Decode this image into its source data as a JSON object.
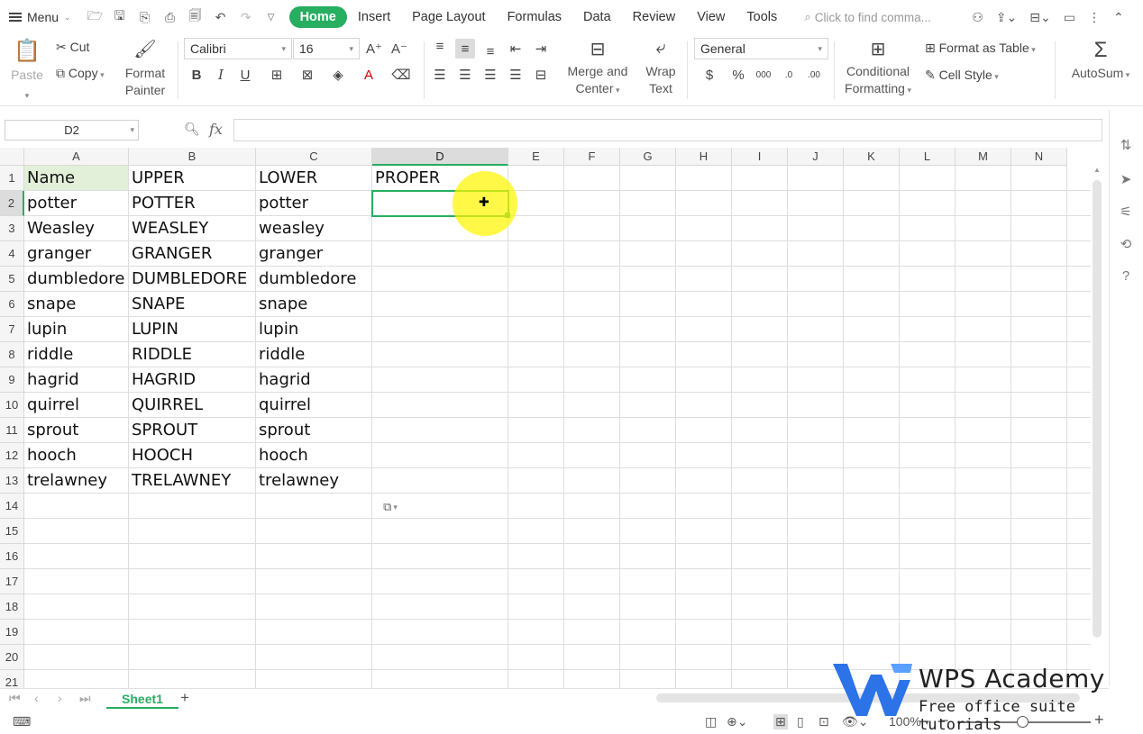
{
  "menubar": {
    "menu_label": "Menu",
    "tabs": [
      "Home",
      "Insert",
      "Page Layout",
      "Formulas",
      "Data",
      "Review",
      "View",
      "Tools"
    ],
    "active_tab": "Home",
    "search_placeholder": "Click to find comma..."
  },
  "ribbon": {
    "paste": "Paste",
    "cut": "Cut",
    "copy": "Copy",
    "format_painter_1": "Format",
    "format_painter_2": "Painter",
    "font_name": "Calibri",
    "font_size": "16",
    "merge_1": "Merge and",
    "merge_2": "Center",
    "wrap_1": "Wrap",
    "wrap_2": "Text",
    "number_format": "General",
    "conditional_1": "Conditional",
    "conditional_2": "Formatting",
    "format_as_table": "Format as Table",
    "cell_style": "Cell Style",
    "autosum": "AutoSum"
  },
  "formula_bar": {
    "name_box": "D2",
    "fx": "fx",
    "formula": ""
  },
  "sheet": {
    "columns": [
      "A",
      "B",
      "C",
      "D",
      "E",
      "F",
      "G",
      "H",
      "I",
      "J",
      "K",
      "L",
      "M",
      "N"
    ],
    "rows": [
      "1",
      "2",
      "3",
      "4",
      "5",
      "6",
      "7",
      "8",
      "9",
      "10",
      "11",
      "12",
      "13",
      "14",
      "15",
      "16",
      "17",
      "18",
      "19",
      "20",
      "21"
    ],
    "cells": [
      [
        "Name",
        "UPPER",
        "LOWER",
        "PROPER"
      ],
      [
        "potter",
        "POTTER",
        "potter",
        ""
      ],
      [
        "Weasley",
        "WEASLEY",
        "weasley",
        ""
      ],
      [
        "granger",
        "GRANGER",
        "granger",
        ""
      ],
      [
        "dumbledore",
        "DUMBLEDORE",
        "dumbledore",
        ""
      ],
      [
        "snape",
        "SNAPE",
        "snape",
        ""
      ],
      [
        "lupin",
        "LUPIN",
        "lupin",
        ""
      ],
      [
        "riddle",
        "RIDDLE",
        "riddle",
        ""
      ],
      [
        "hagrid",
        "HAGRID",
        "hagrid",
        ""
      ],
      [
        "quirrel",
        "QUIRREL",
        "quirrel",
        ""
      ],
      [
        "sprout",
        "SPROUT",
        "sprout",
        ""
      ],
      [
        "hooch",
        "HOOCH",
        "hooch",
        ""
      ],
      [
        "trelawney",
        "TRELAWNEY",
        "trelawney",
        ""
      ]
    ],
    "selected_cell": "D2",
    "tab_name": "Sheet1"
  },
  "status": {
    "zoom": "100%"
  },
  "watermark": {
    "title": "WPS Academy",
    "subtitle": "Free office suite tutorials"
  },
  "colors": {
    "accent": "#27ae60",
    "header_fill_a1": "#e2efd9",
    "highlight": "#fff500"
  }
}
